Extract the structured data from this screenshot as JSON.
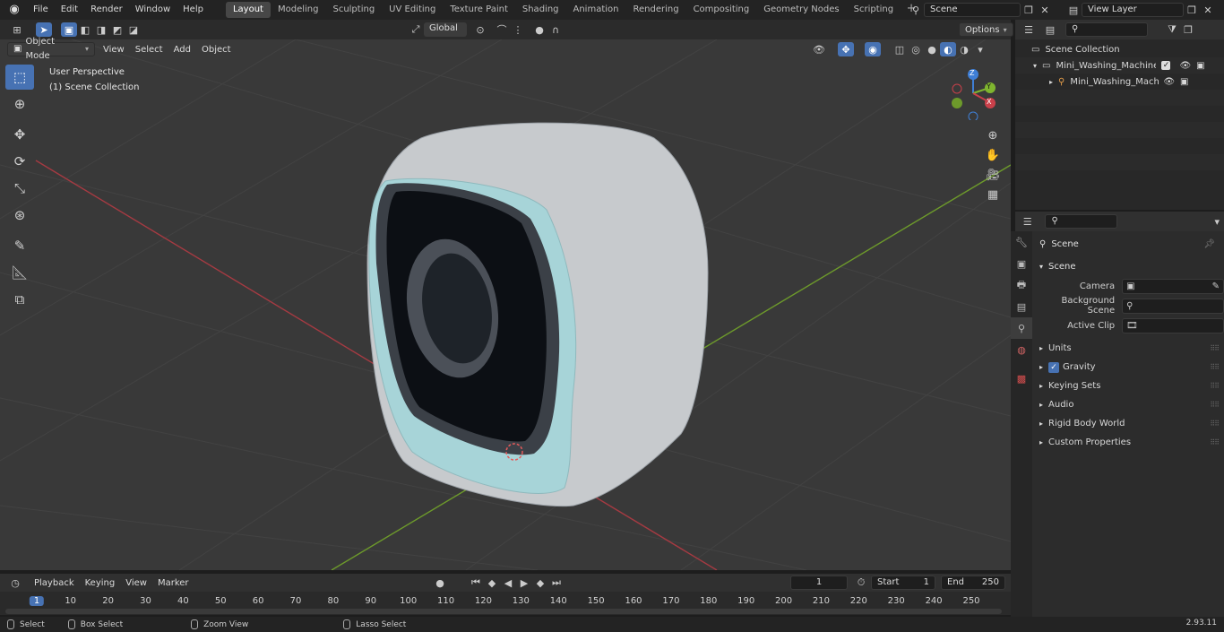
{
  "topbar": {
    "menus": [
      "File",
      "Edit",
      "Render",
      "Window",
      "Help"
    ],
    "workspaces": [
      "Layout",
      "Modeling",
      "Sculpting",
      "UV Editing",
      "Texture Paint",
      "Shading",
      "Animation",
      "Rendering",
      "Compositing",
      "Geometry Nodes",
      "Scripting"
    ],
    "active_workspace": "Layout",
    "scene_name": "Scene",
    "view_layer": "View Layer"
  },
  "viewport_header": {
    "mode": "Object Mode",
    "menus": [
      "View",
      "Select",
      "Add",
      "Object"
    ],
    "transform_orientation": "Global",
    "options_label": "Options"
  },
  "viewport": {
    "perspective_label": "User Perspective",
    "collection_label": "(1) Scene Collection",
    "axes": {
      "x": "X",
      "y": "Y",
      "z": "Z"
    }
  },
  "outliner": {
    "root": "Scene Collection",
    "items": [
      "Mini_Washing_Machine_Wall_",
      "Mini_Washing_Machine_V"
    ]
  },
  "properties": {
    "context": "Scene",
    "panel": "Scene",
    "fields": [
      {
        "label": "Camera"
      },
      {
        "label": "Background Scene"
      },
      {
        "label": "Active Clip"
      }
    ],
    "subpanels": [
      "Units",
      "Gravity",
      "Keying Sets",
      "Audio",
      "Rigid Body World",
      "Custom Properties"
    ]
  },
  "timeline": {
    "menus": [
      "Playback",
      "Keying",
      "View",
      "Marker"
    ],
    "current_frame": "1",
    "start_label": "Start",
    "start_value": "1",
    "end_label": "End",
    "end_value": "250",
    "ruler": [
      "1",
      "10",
      "20",
      "30",
      "40",
      "50",
      "60",
      "70",
      "80",
      "90",
      "100",
      "110",
      "120",
      "130",
      "140",
      "150",
      "160",
      "170",
      "180",
      "190",
      "200",
      "210",
      "220",
      "230",
      "240",
      "250"
    ]
  },
  "statusbar": {
    "items": [
      "Select",
      "Box Select",
      "Zoom View",
      "Lasso Select"
    ],
    "version": "2.93.11"
  },
  "colors": {
    "accent": "#4772b3",
    "x_axis": "#c9404a",
    "y_axis": "#7fb52f",
    "z_axis": "#3f7fd6",
    "body": "#c9cccf",
    "trim": "#a8d5d9"
  }
}
